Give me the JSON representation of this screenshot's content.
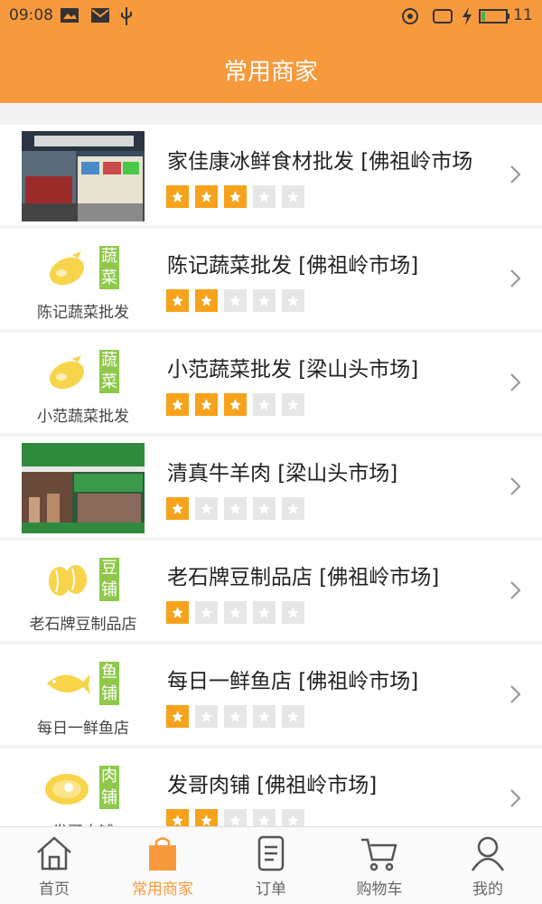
{
  "status_bar": {
    "time": "09:08",
    "battery": "11"
  },
  "header": {
    "title": "常用商家"
  },
  "colors": {
    "accent": "#f79a3e",
    "star_on": "#f7a21b",
    "star_off": "#e6e6e6",
    "tag_green": "#8fc84a"
  },
  "merchants": [
    {
      "name": "家佳康冰鲜食材批发 [佛祖岭市场",
      "rating": 3,
      "thumb": "photo-storefront",
      "logo_text": "",
      "tag": ""
    },
    {
      "name": "陈记蔬菜批发 [佛祖岭市场]",
      "rating": 2,
      "thumb": "eggplant-icon",
      "logo_text": "陈记蔬菜批发",
      "tag": "蔬菜"
    },
    {
      "name": "小范蔬菜批发 [梁山头市场]",
      "rating": 3,
      "thumb": "eggplant-icon",
      "logo_text": "小范蔬菜批发",
      "tag": "蔬菜"
    },
    {
      "name": "清真牛羊肉 [梁山头市场]",
      "rating": 1,
      "thumb": "photo-halal-shop",
      "logo_text": "",
      "tag": "",
      "sign_text": "清真牛羊肉"
    },
    {
      "name": "老石牌豆制品店 [佛祖岭市场]",
      "rating": 1,
      "thumb": "bean-icon",
      "logo_text": "老石牌豆制品店",
      "tag": "豆铺"
    },
    {
      "name": "每日一鲜鱼店 [佛祖岭市场]",
      "rating": 1,
      "thumb": "fish-icon",
      "logo_text": "每日一鲜鱼店",
      "tag": "鱼铺"
    },
    {
      "name": "发哥肉铺 [佛祖岭市场]",
      "rating": 2,
      "thumb": "meat-icon",
      "logo_text": "发哥肉铺",
      "tag": "肉铺"
    }
  ],
  "tabs": [
    {
      "label": "首页",
      "icon": "home-icon",
      "active": false
    },
    {
      "label": "常用商家",
      "icon": "bag-icon",
      "active": true
    },
    {
      "label": "订单",
      "icon": "order-icon",
      "active": false
    },
    {
      "label": "购物车",
      "icon": "cart-icon",
      "active": false
    },
    {
      "label": "我的",
      "icon": "user-icon",
      "active": false
    }
  ]
}
